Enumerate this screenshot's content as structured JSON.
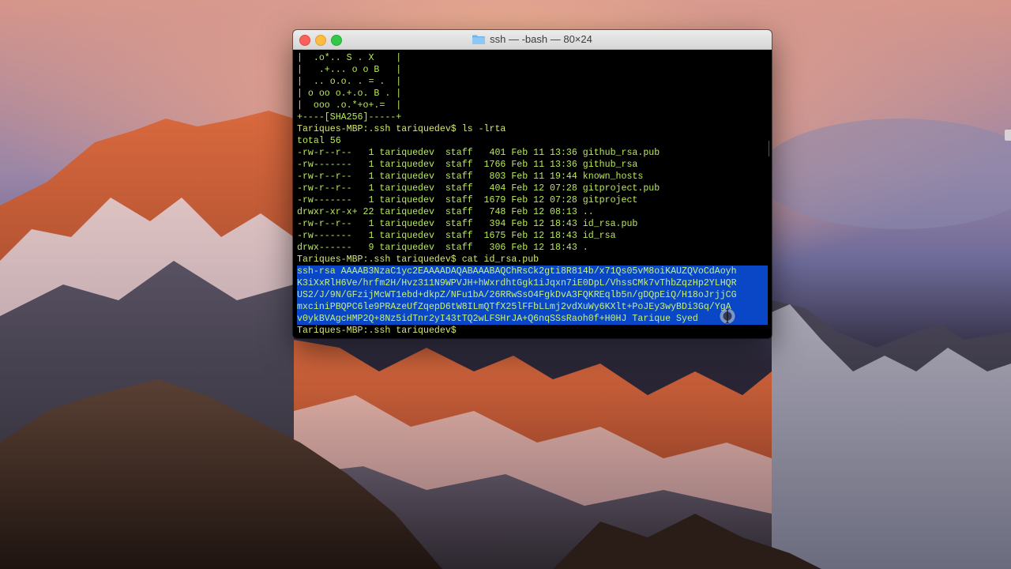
{
  "window": {
    "title": "ssh — -bash — 80×24",
    "folder_icon": "folder-icon"
  },
  "colors": {
    "terminal_bg": "#000000",
    "terminal_text": "#b9e85a",
    "selection": "#0a47c6",
    "close": "#fc605c",
    "minimize": "#fdbc40",
    "zoom": "#34c84a"
  },
  "terminal": {
    "lines": [
      "|  .o*.. S . X    |",
      "|   .+... o o B   |",
      "|  .. o.o. . = .  |",
      "| o oo o.+.o. B . |",
      "|  ooo .o.*+o+.=  |",
      "+----[SHA256]-----+",
      "Tariques-MBP:.ssh tariquedev$ ls -lrta",
      "total 56",
      "-rw-r--r--   1 tariquedev  staff   401 Feb 11 13:36 github_rsa.pub",
      "-rw-------   1 tariquedev  staff  1766 Feb 11 13:36 github_rsa",
      "-rw-r--r--   1 tariquedev  staff   803 Feb 11 19:44 known_hosts",
      "-rw-r--r--   1 tariquedev  staff   404 Feb 12 07:28 gitproject.pub",
      "-rw-------   1 tariquedev  staff  1679 Feb 12 07:28 gitproject",
      "drwxr-xr-x+ 22 tariquedev  staff   748 Feb 12 08:13 ..",
      "-rw-r--r--   1 tariquedev  staff   394 Feb 12 18:43 id_rsa.pub",
      "-rw-------   1 tariquedev  staff  1675 Feb 12 18:43 id_rsa",
      "drwx------   9 tariquedev  staff   306 Feb 12 18:43 .",
      "Tariques-MBP:.ssh tariquedev$ cat id_rsa.pub",
      "ssh-rsa AAAAB3NzaC1yc2EAAAADAQABAAABAQChRsCk2gti8R814b/x71Qs05vM8oiKAUZQVoCdAoyh",
      "K3iXxRlH6Ve/hrfm2H/Hvz311N9WPVJH+hWxrdhtGgk1iJqxn7iE0DpL/VhssCMk7vThbZqzHp2YLHQR",
      "US2/J/9N/GFzijMcWT1ebd+dkpZ/NFu1bA/26RRwSsO4FgkDvA3FQKREqlb5n/gDQpEiQ/H18oJrjjCG",
      "mxciniPBQPC6le9PRAzeUfZqepD6tW8ILmQTfX25lFFbLLmj2vdXuWy6KXlt+PoJEy3wyBDi3Gq/YgA",
      "v0ykBVAgcHMP2Q+8Nz5idTnr2yI43tTQ2wLFSHrJA+Q6nqSSsRaoh0f+H0HJ Tarique Syed",
      "Tariques-MBP:.ssh tariquedev$ "
    ]
  }
}
